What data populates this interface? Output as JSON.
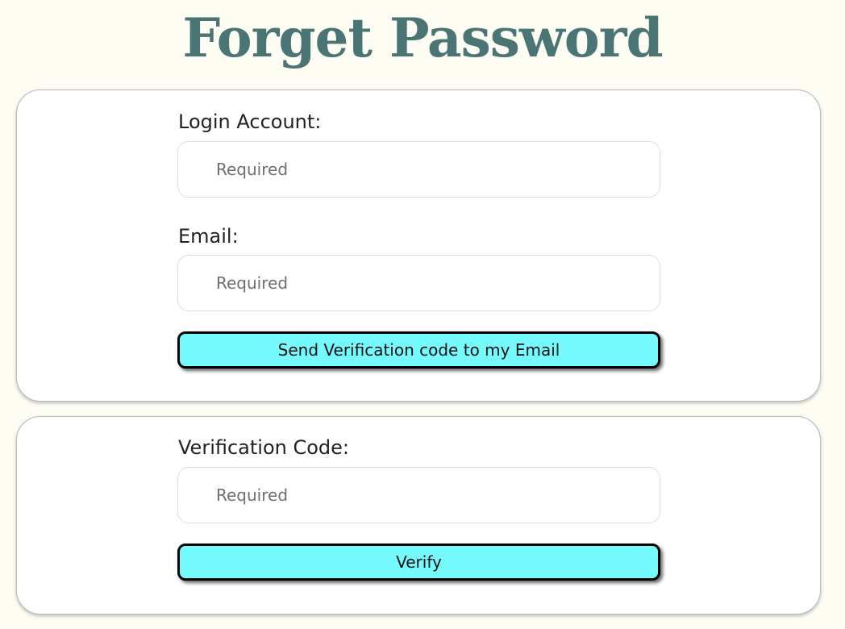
{
  "page": {
    "title": "Forget Password"
  },
  "request_form": {
    "login_account": {
      "label": "Login Account:",
      "placeholder": "Required",
      "value": ""
    },
    "email": {
      "label": "Email:",
      "placeholder": "Required",
      "value": ""
    },
    "send_button_label": "Send Verification code to my Email"
  },
  "verify_form": {
    "verification_code": {
      "label": "Verification Code:",
      "placeholder": "Required",
      "value": ""
    },
    "verify_button_label": "Verify"
  },
  "colors": {
    "title": "#4a7574",
    "button_fill": "#75fbfd",
    "page_background": "#fdfdf4"
  }
}
